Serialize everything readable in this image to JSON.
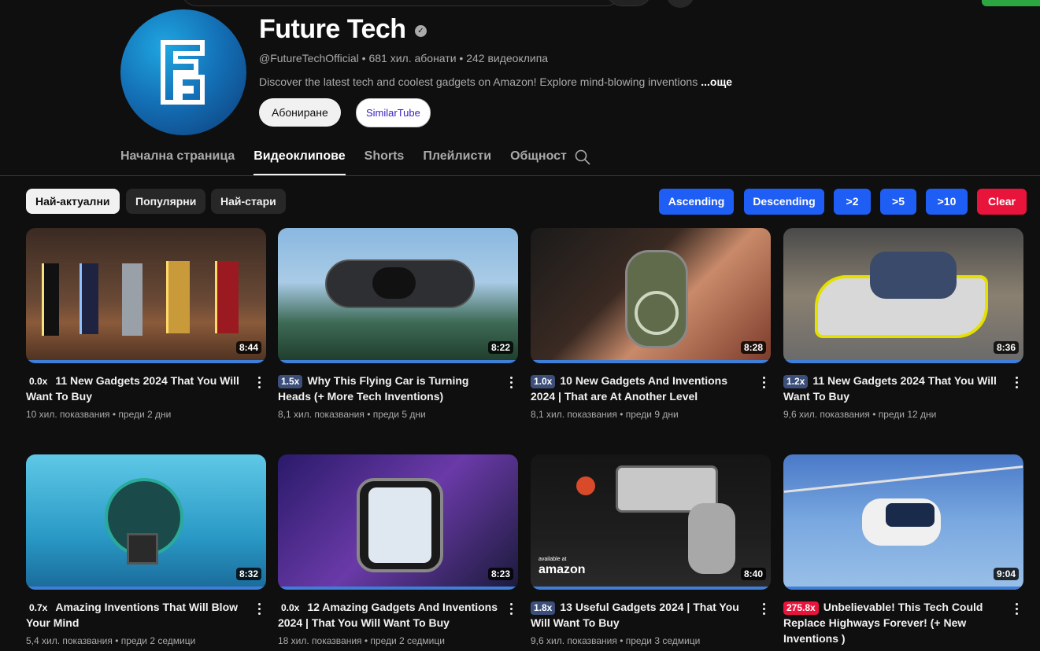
{
  "channel": {
    "name": "Future Tech",
    "meta": "@FutureTechOfficial • 681 хил. абонати • 242 видеоклипа",
    "description": "Discover the latest tech and coolest gadgets on Amazon! Explore mind-blowing inventions",
    "more": "...още",
    "subscribe_label": "Абониране",
    "similartube_label": "SimilarTube"
  },
  "tabs": [
    "Начална страница",
    "Видеоклипове",
    "Shorts",
    "Плейлисти",
    "Общност"
  ],
  "chips": [
    "Най-актуални",
    "Популярни",
    "Най-стари"
  ],
  "filters": [
    "Ascending",
    "Descending",
    ">2",
    ">5",
    ">10",
    "Clear"
  ],
  "colors": {
    "accent_blue": "#1f5ef5",
    "clear_red": "#e8143c",
    "speed_blue": "#3c4f7a"
  },
  "videos": [
    {
      "speed": "0.0x",
      "title": "11 New Gadgets 2024 That You Will Want To Buy",
      "meta": "10 хил. показвания • преди 2 дни",
      "duration": "8:44"
    },
    {
      "speed": "1.5x",
      "title": "Why This Flying Car is Turning Heads (+ More Tech Inventions)",
      "meta": "8,1 хил. показвания • преди 5 дни",
      "duration": "8:22"
    },
    {
      "speed": "1.0x",
      "title": "10 New Gadgets And Inventions 2024 | That are At Another Level",
      "meta": "8,1 хил. показвания • преди 9 дни",
      "duration": "8:28"
    },
    {
      "speed": "1.2x",
      "title": "11 New Gadgets 2024 That You Will Want To Buy",
      "meta": "9,6 хил. показвания • преди 12 дни",
      "duration": "8:36"
    },
    {
      "speed": "0.7x",
      "title": "Amazing Inventions That Will Blow Your Mind",
      "meta": "5,4 хил. показвания • преди 2 седмици",
      "duration": "8:32"
    },
    {
      "speed": "0.0x",
      "title": "12 Amazing Gadgets And Inventions 2024 | That You Will Want To Buy",
      "meta": "18 хил. показвания • преди 2 седмици",
      "duration": "8:23"
    },
    {
      "speed": "1.8x",
      "title": "13 Useful Gadgets 2024 | That You Will Want To Buy",
      "meta": "9,6 хил. показвания • преди 3 седмици",
      "duration": "8:40",
      "thumb_text_small": "available at",
      "thumb_text": "amazon"
    },
    {
      "speed": "275.8x",
      "title": "Unbelievable! This Tech Could Replace Highways Forever! (+ New Inventions )",
      "meta": "",
      "duration": "9:04"
    }
  ]
}
